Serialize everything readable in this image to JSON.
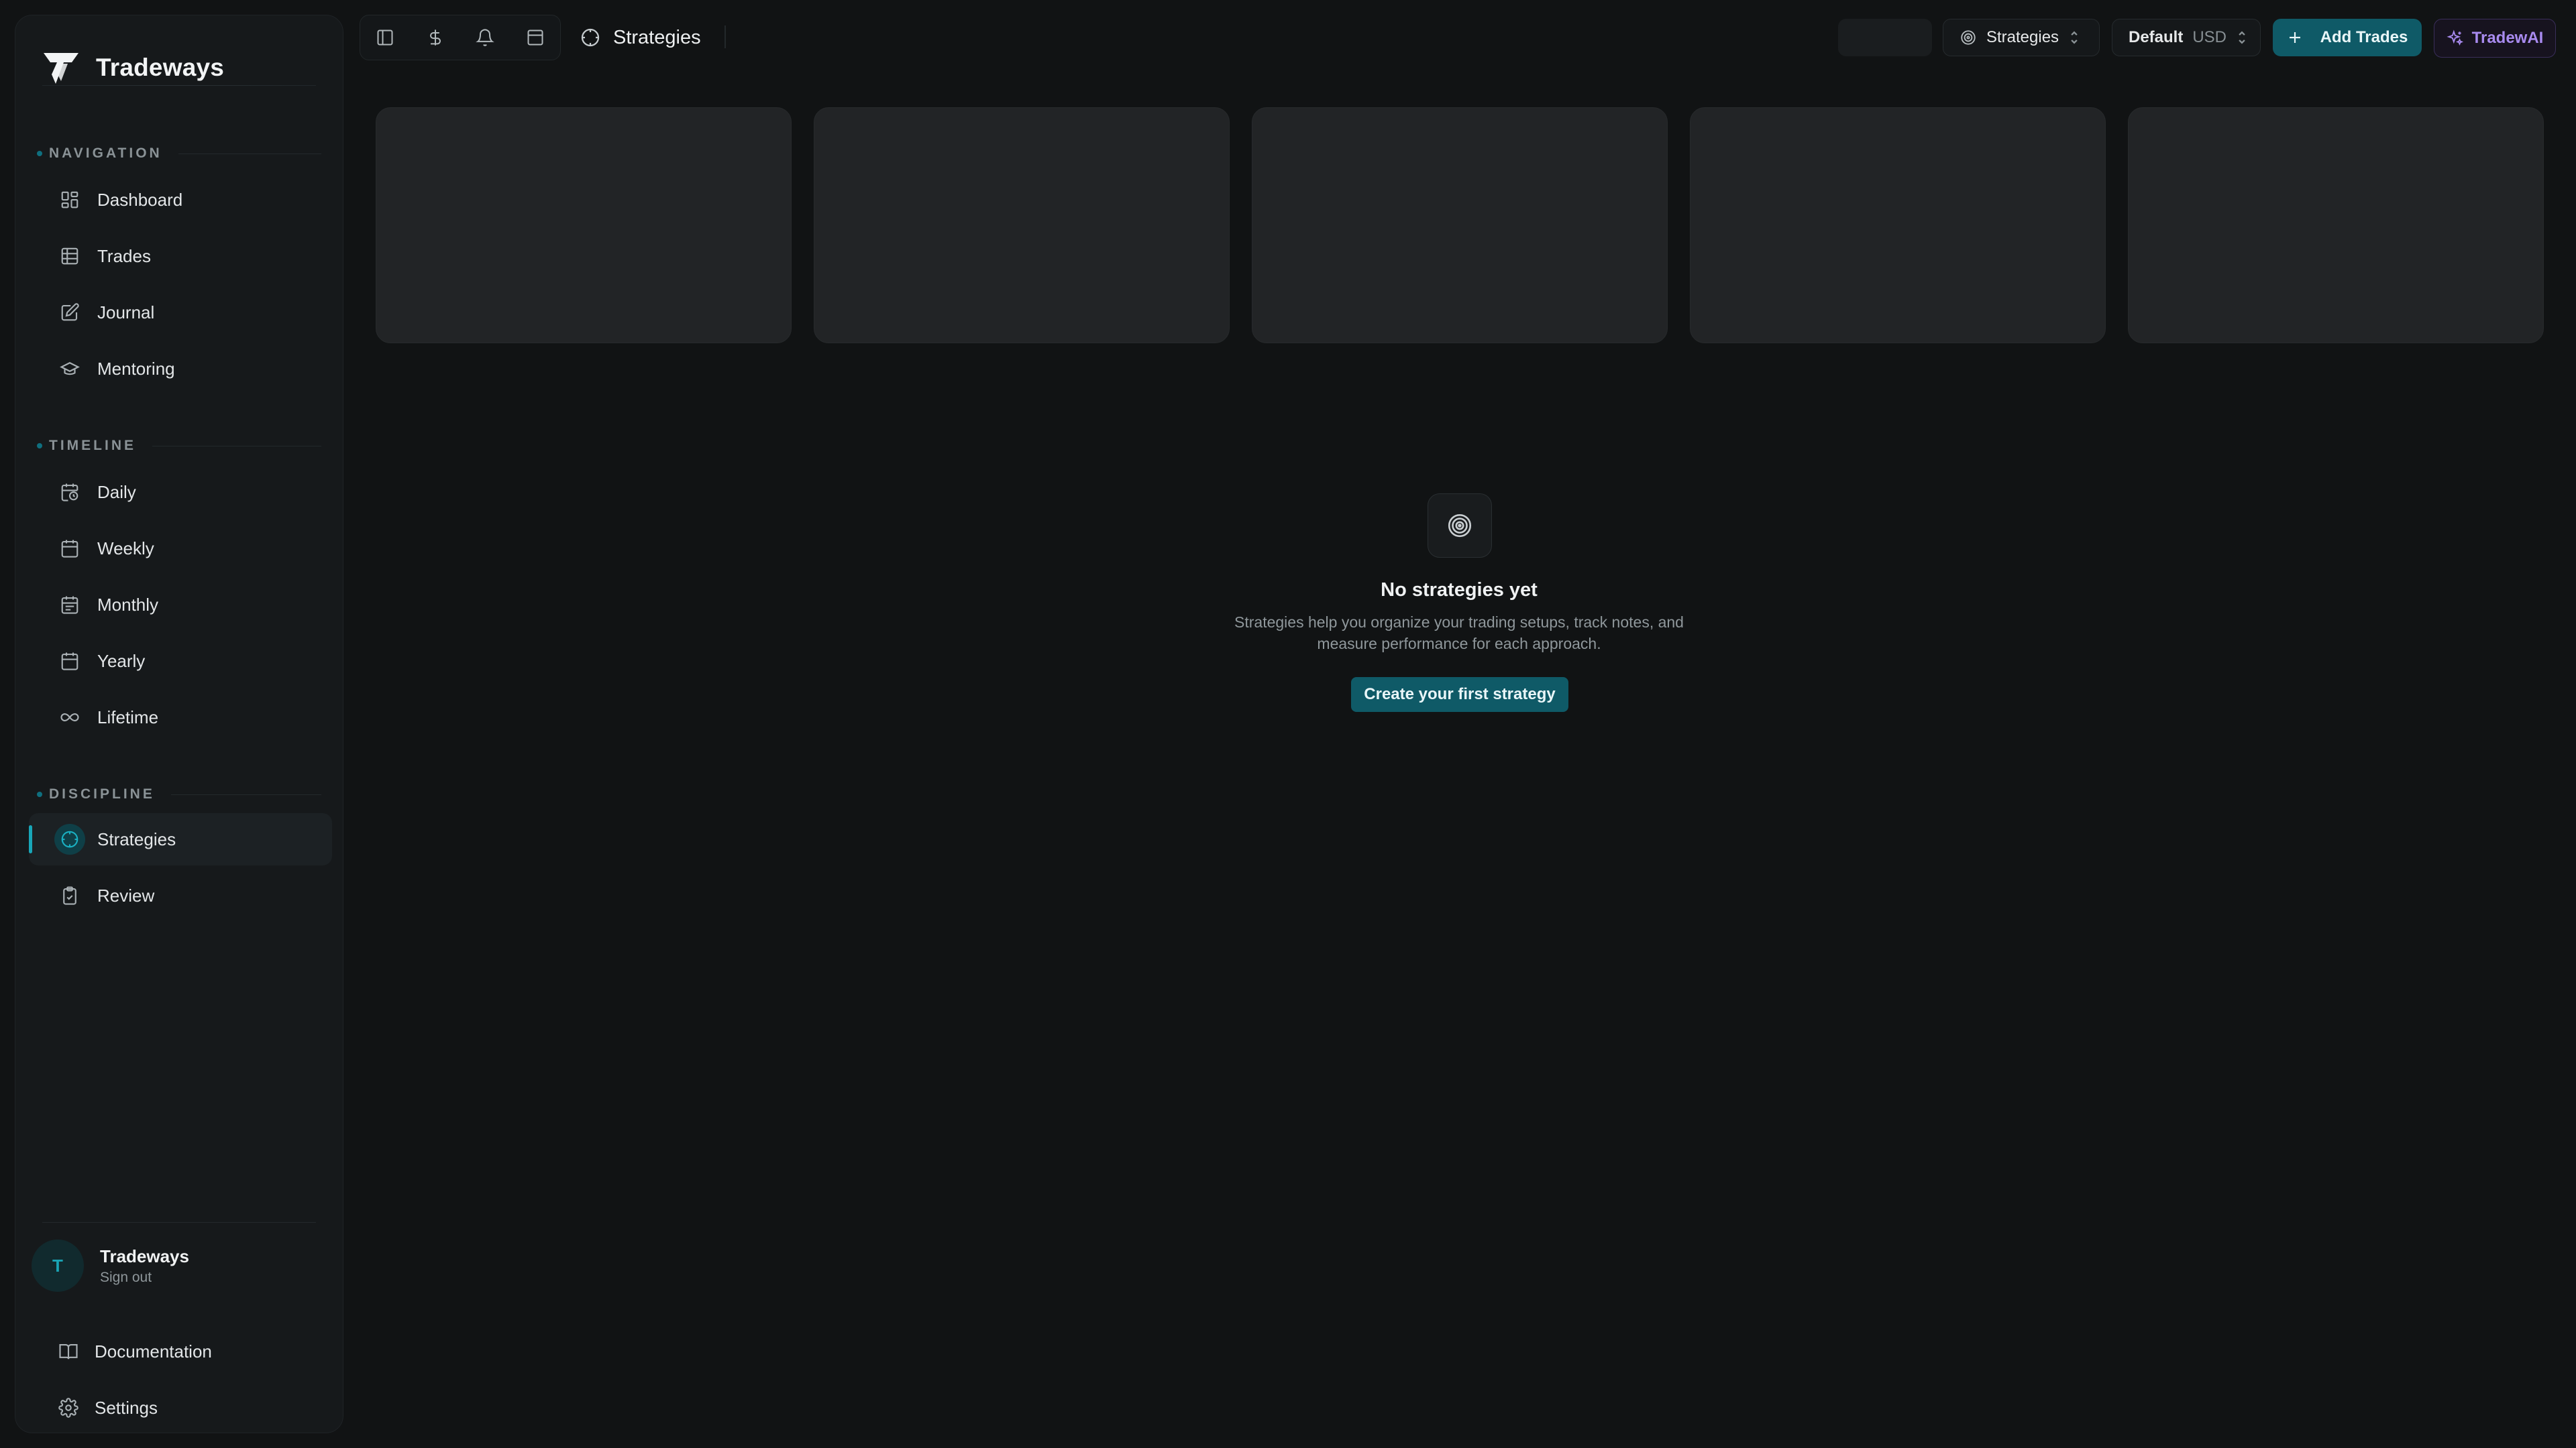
{
  "app": {
    "name": "Tradeways"
  },
  "sidebar": {
    "sections": [
      {
        "label": "NAVIGATION",
        "items": [
          {
            "label": "Dashboard",
            "icon": "dashboard-icon"
          },
          {
            "label": "Trades",
            "icon": "table-icon"
          },
          {
            "label": "Journal",
            "icon": "journal-edit-icon"
          },
          {
            "label": "Mentoring",
            "icon": "graduation-cap-icon"
          }
        ]
      },
      {
        "label": "TIMELINE",
        "items": [
          {
            "label": "Daily",
            "icon": "calendar-clock-icon"
          },
          {
            "label": "Weekly",
            "icon": "calendar-icon"
          },
          {
            "label": "Monthly",
            "icon": "calendar-icon"
          },
          {
            "label": "Yearly",
            "icon": "calendar-icon"
          },
          {
            "label": "Lifetime",
            "icon": "infinity-icon"
          }
        ]
      },
      {
        "label": "DISCIPLINE",
        "items": [
          {
            "label": "Strategies",
            "icon": "crosshair-icon",
            "active": true
          },
          {
            "label": "Review",
            "icon": "clipboard-check-icon"
          }
        ]
      }
    ],
    "user": {
      "initial": "T",
      "name": "Tradeways",
      "action": "Sign out"
    },
    "footer": {
      "docs": "Documentation",
      "settings": "Settings"
    }
  },
  "topbar": {
    "page_title": "Strategies",
    "strategy_select": "Strategies",
    "account_select": {
      "name": "Default",
      "currency": "USD"
    },
    "add_trades": "Add Trades",
    "ai": "TradewAI"
  },
  "empty_state": {
    "title": "No strategies yet",
    "line1": "Strategies help you organize your trading setups, track notes, and",
    "line2": "measure performance for each approach.",
    "cta": "Create your first strategy"
  },
  "colors": {
    "accent": "#0f5a67",
    "accent_bright": "#18a6b8",
    "ai": "#a98bf0",
    "bg": "#111314",
    "sidebar": "#16191b",
    "card": "#222426"
  }
}
